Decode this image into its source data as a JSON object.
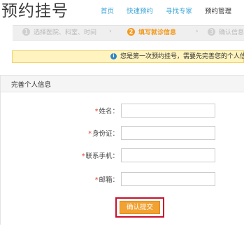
{
  "page": {
    "title": "预约挂号"
  },
  "nav": {
    "items": [
      "首页",
      "快速预约",
      "寻找专家",
      "预约管理"
    ]
  },
  "steps": [
    {
      "num": "1",
      "label": "选择医院、科室、时间"
    },
    {
      "num": "2",
      "label": "填写就诊信息"
    },
    {
      "num": "3",
      "label": "确认信息"
    }
  ],
  "step_separator": "›",
  "notice": {
    "icon": "info-icon",
    "text": "您是第一次预约挂号，需要先完善您的个人信息"
  },
  "form": {
    "section_title": "完善个人信息",
    "required_mark": "*",
    "fields": [
      {
        "label": "姓名：",
        "value": "",
        "placeholder": ""
      },
      {
        "label": "身份证：",
        "value": "",
        "placeholder": ""
      },
      {
        "label": "联系手机：",
        "value": "",
        "placeholder": ""
      },
      {
        "label": "邮箱：",
        "value": "",
        "placeholder": ""
      }
    ],
    "submit_label": "确认提交"
  },
  "colors": {
    "accent_orange": "#f39a1e",
    "link_blue": "#3aa5d6",
    "required_red": "#e23c2a",
    "highlight_box": "#c8102e",
    "notice_bg": "#fff3bf"
  }
}
